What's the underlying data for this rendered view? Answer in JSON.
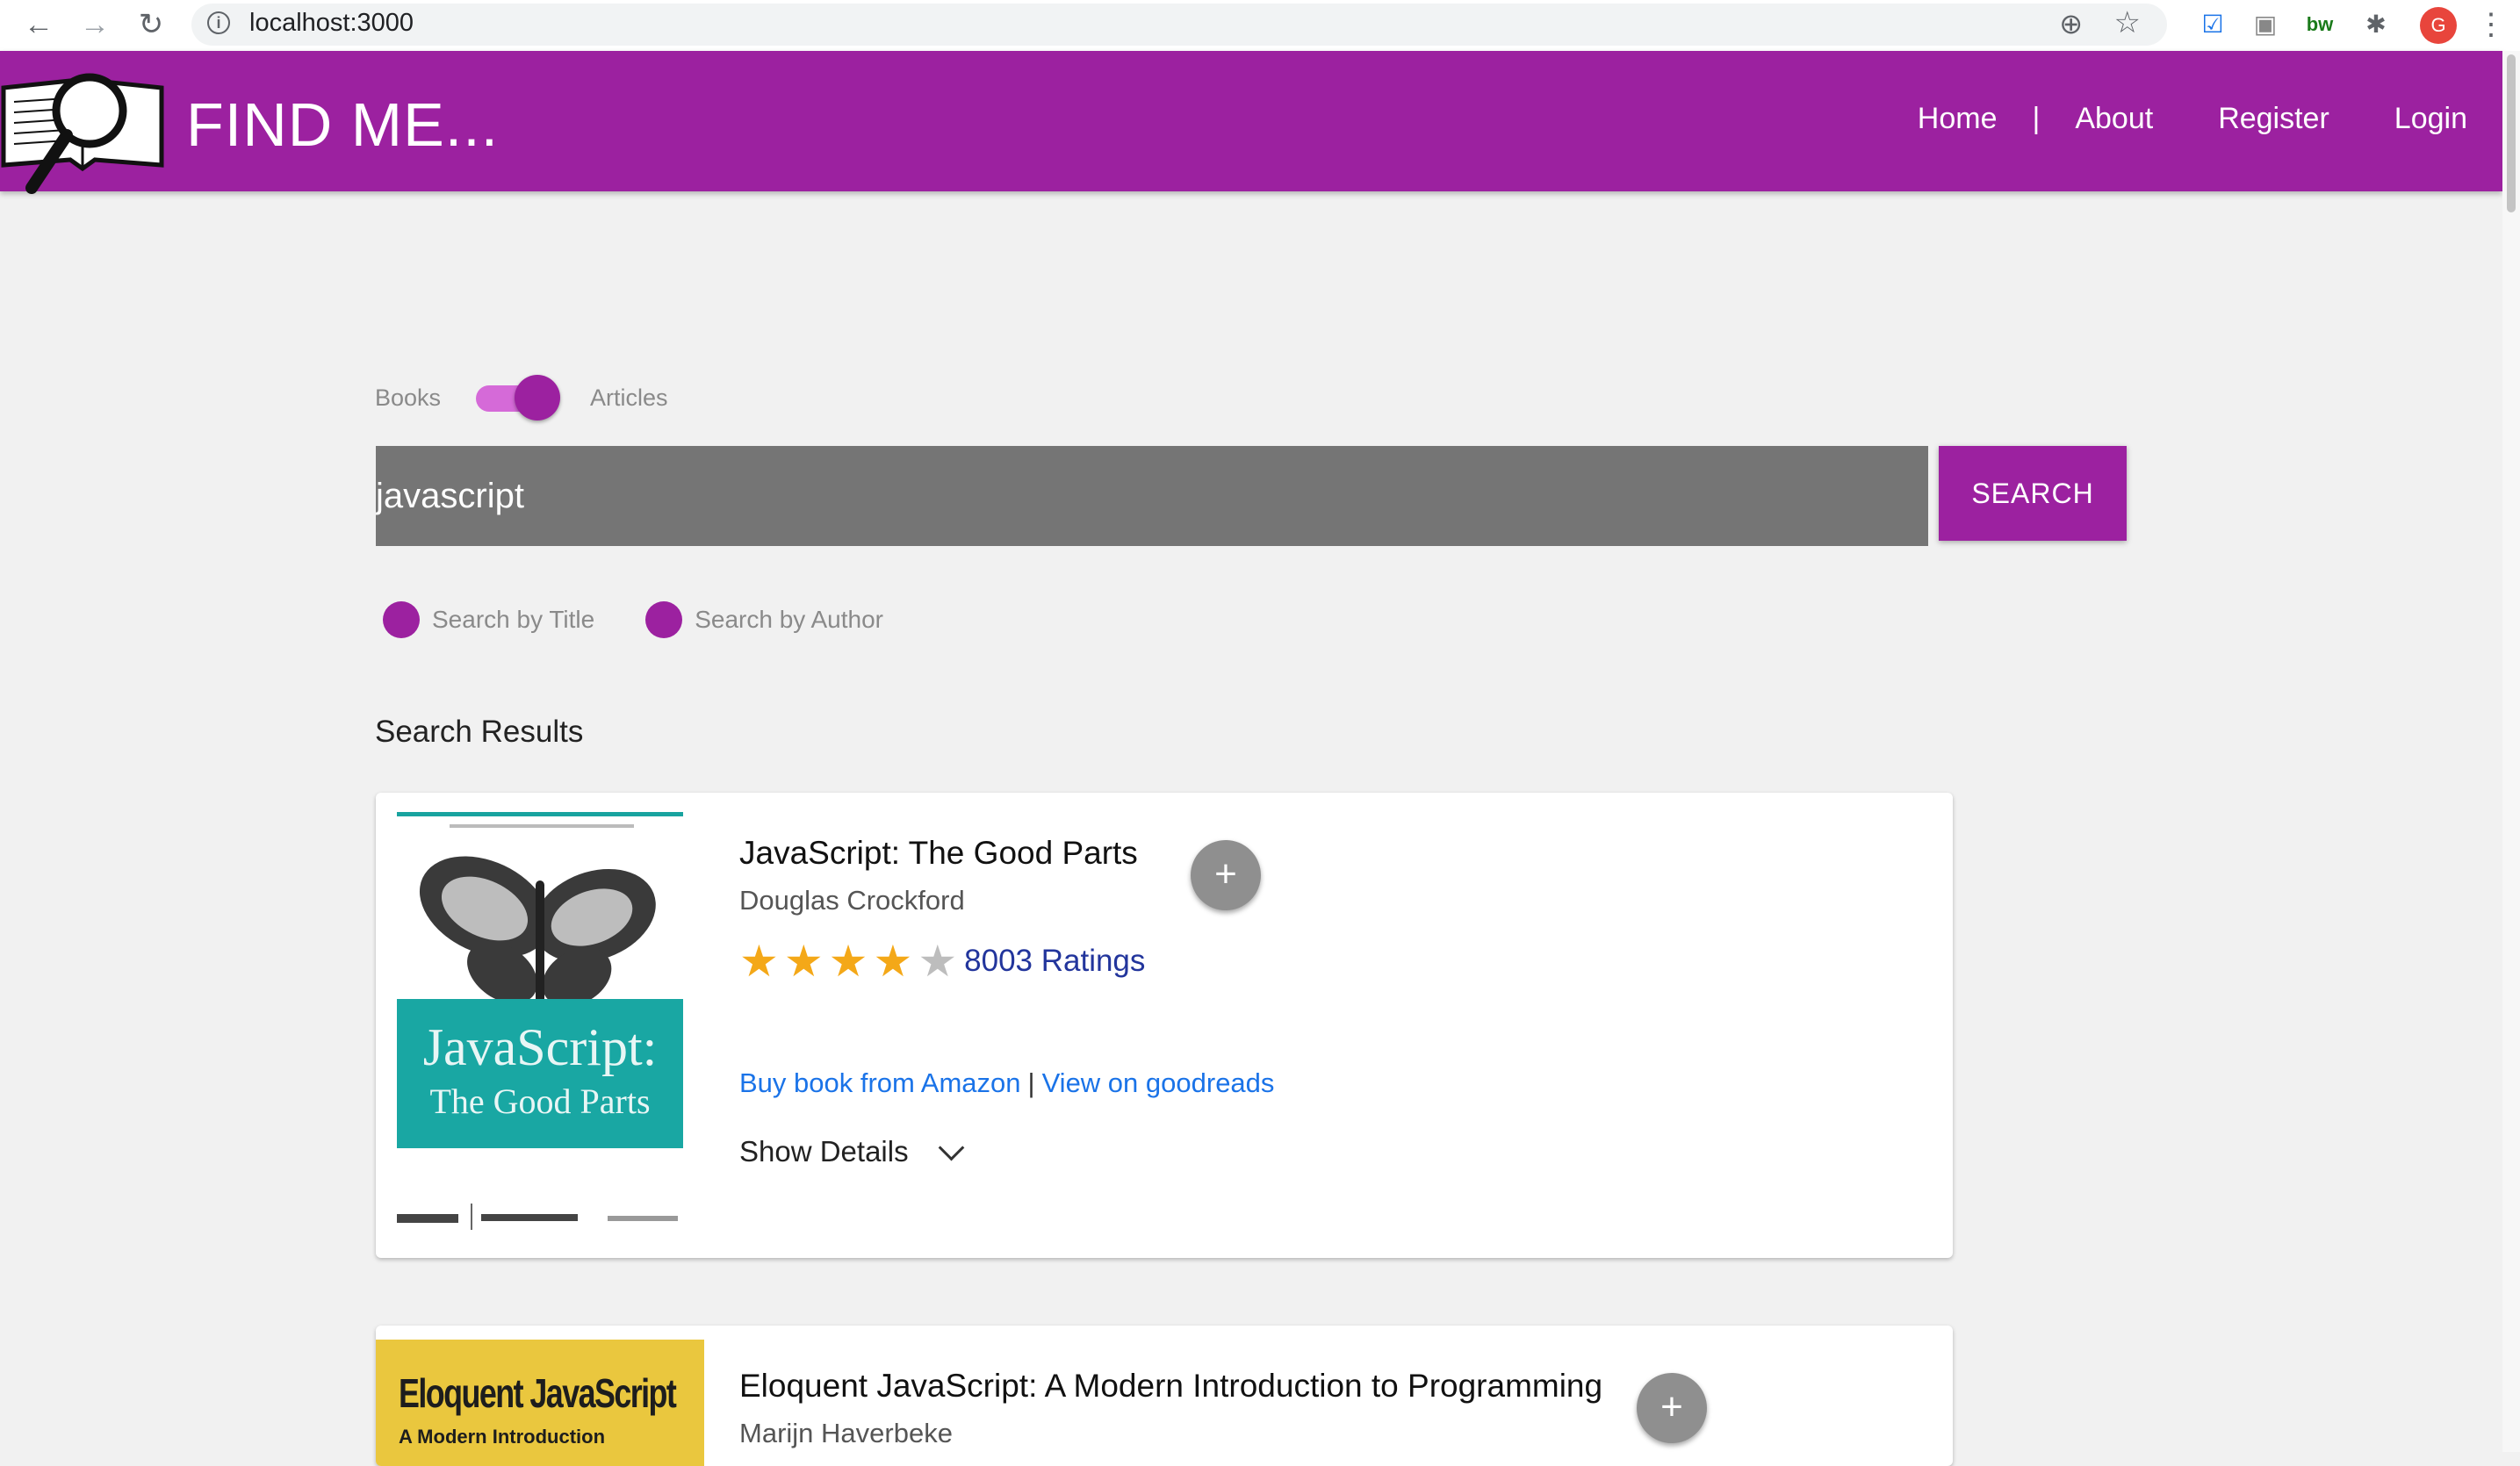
{
  "browser": {
    "url": "localhost:3000",
    "profile_initial": "G"
  },
  "header": {
    "brand": "FIND ME...",
    "nav": {
      "home": "Home",
      "separator": "|",
      "about": "About",
      "register": "Register",
      "login": "Login"
    }
  },
  "toggle": {
    "left_label": "Books",
    "right_label": "Articles",
    "state": "articles"
  },
  "search": {
    "value": "javascript",
    "button_label": "SEARCH"
  },
  "options": {
    "title_label": "Search by Title",
    "author_label": "Search by Author"
  },
  "results": {
    "heading": "Search Results",
    "items": [
      {
        "title": "JavaScript: The Good Parts",
        "author": "Douglas Crockford",
        "rating_stars": 4,
        "ratings_text": "8003 Ratings",
        "buy_link": "Buy book from Amazon",
        "link_divider": "|",
        "goodreads_link": "View on goodreads",
        "details_label": "Show Details",
        "cover_title_line1": "JavaScript:",
        "cover_title_line2": "The Good Parts"
      },
      {
        "title": "Eloquent JavaScript: A Modern Introduction to Programming",
        "author": "Marijn Haverbeke",
        "cover_title": "Eloquent JavaScript",
        "cover_subtitle": "A Modern Introduction"
      }
    ]
  },
  "colors": {
    "brand_purple": "#9c21a0",
    "star_gold": "#f4a818",
    "link_blue": "#1a73e8"
  }
}
